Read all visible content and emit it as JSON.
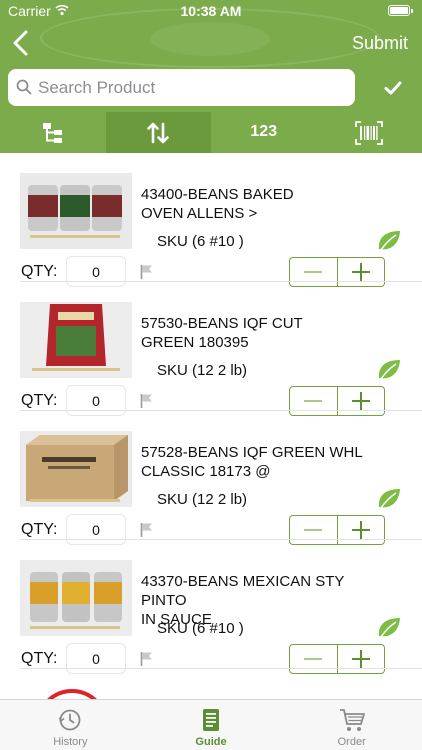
{
  "status_bar": {
    "carrier": "Carrier",
    "time": "10:38 AM"
  },
  "header": {
    "submit_label": "Submit"
  },
  "search": {
    "placeholder": "Search Product",
    "value": ""
  },
  "toolbar": {
    "numeric_label": "123"
  },
  "qty_label": "QTY:",
  "products": [
    {
      "name_line1": "43400-BEANS BAKED",
      "name_line2": "OVEN ALLENS >",
      "sku": "SKU (6 #10 )",
      "qty": "0",
      "image": "canned-beans-photo"
    },
    {
      "name_line1": "57530-BEANS IQF CUT",
      "name_line2": "GREEN 180395",
      "sku": "SKU (12 2 lb)",
      "qty": "0",
      "image": "frozen-bag-photo"
    },
    {
      "name_line1": "57528-BEANS IQF GREEN WHL",
      "name_line2": "CLASSIC 18173 @",
      "sku": "SKU (12 2 lb)",
      "qty": "0",
      "image": "cardboard-case-photo"
    },
    {
      "name_line1": "43370-BEANS MEXICAN STY PINTO",
      "name_line2": "IN SAUCE",
      "sku": "SKU (6 #10 )",
      "qty": "0",
      "image": "canned-pinto-photo"
    }
  ],
  "tabs": [
    {
      "label": "History",
      "icon": "history-icon"
    },
    {
      "label": "Guide",
      "icon": "guide-icon",
      "active": true
    },
    {
      "label": "Order",
      "icon": "cart-icon"
    }
  ],
  "colors": {
    "header_green": "#7bab4a",
    "accent_green": "#6fa33f",
    "leaf_green": "#7dbd45"
  }
}
